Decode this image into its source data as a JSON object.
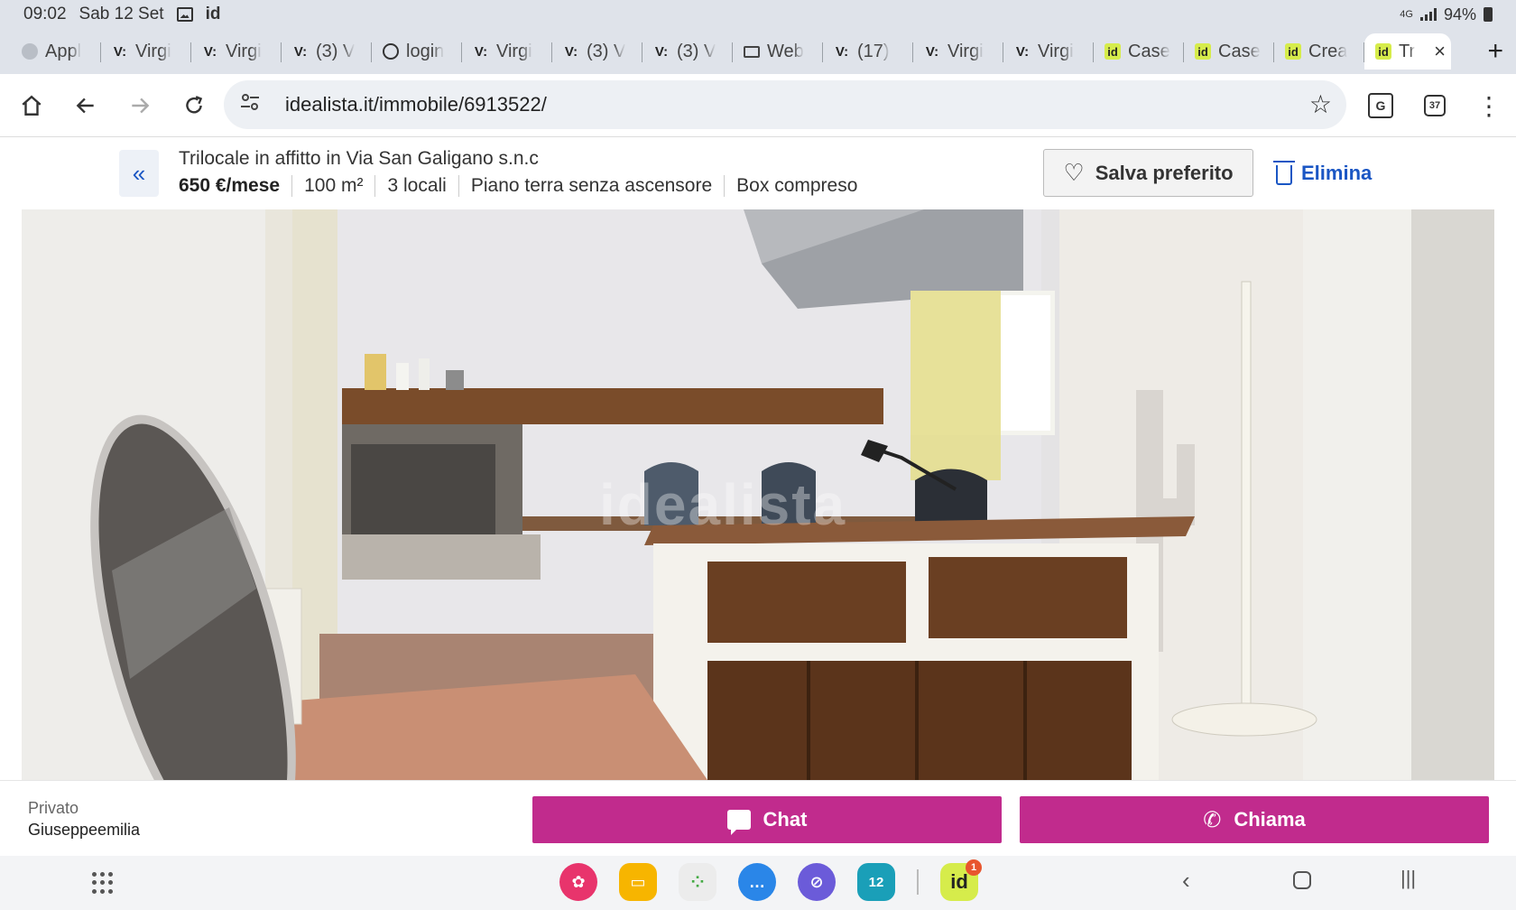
{
  "status_bar": {
    "time": "09:02",
    "date": "Sab 12 Set",
    "app_badge": "id",
    "network": "4G",
    "battery": "94%"
  },
  "tabs": [
    {
      "favicon": "app",
      "label": "Appl"
    },
    {
      "favicon": "v",
      "label": "Virgi"
    },
    {
      "favicon": "v",
      "label": "Virgi"
    },
    {
      "favicon": "v",
      "label": "(3) V"
    },
    {
      "favicon": "globe",
      "label": "login"
    },
    {
      "favicon": "v",
      "label": "Virgi"
    },
    {
      "favicon": "v",
      "label": "(3) V"
    },
    {
      "favicon": "v",
      "label": "(3) V"
    },
    {
      "favicon": "mail",
      "label": "Web"
    },
    {
      "favicon": "v",
      "label": "(17)"
    },
    {
      "favicon": "v",
      "label": "Virgi"
    },
    {
      "favicon": "v",
      "label": "Virgi"
    },
    {
      "favicon": "id",
      "label": "Case"
    },
    {
      "favicon": "id",
      "label": "Case"
    },
    {
      "favicon": "id",
      "label": "Crea"
    },
    {
      "favicon": "id",
      "label": "Tr",
      "active": true
    }
  ],
  "toolbar": {
    "url": "idealista.it/immobile/6913522/",
    "tab_count": "37"
  },
  "listing": {
    "title": "Trilocale in affitto in Via San Galigano s.n.c",
    "price": "650 €/mese",
    "size": "100 m²",
    "rooms": "3 locali",
    "floor": "Piano terra senza ascensore",
    "garage": "Box compreso",
    "save_label": "Salva preferito",
    "delete_label": "Elimina"
  },
  "photo": {
    "watermark": "idealista"
  },
  "contact": {
    "owner_type": "Privato",
    "owner_name": "Giuseppeemilia",
    "chat_label": "Chat",
    "call_label": "Chiama"
  },
  "dock": {
    "calendar_day": "12",
    "idealista_label": "id",
    "idealista_badge": "1"
  },
  "colors": {
    "accent": "#c12b8d",
    "link": "#1a56c4",
    "id_green": "#d6ec4b"
  }
}
